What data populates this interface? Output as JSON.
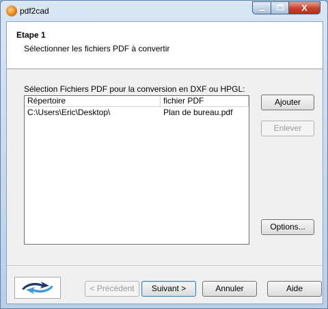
{
  "window": {
    "title": "pdf2cad",
    "close_glyph": "X"
  },
  "header": {
    "step_title": "Etape 1",
    "step_description": "Sélectionner les fichiers PDF à convertir"
  },
  "file_list": {
    "label": "Sélection Fichiers PDF pour la conversion en DXF ou HPGL:",
    "columns": [
      "Répertoire",
      "fichier PDF"
    ],
    "rows": [
      [
        "C:\\Users\\Eric\\Desktop\\",
        "Plan de bureau.pdf"
      ]
    ]
  },
  "side_buttons": {
    "add": "Ajouter",
    "remove": "Enlever",
    "options": "Options..."
  },
  "footer": {
    "previous": "< Précédent",
    "next": "Suivant >",
    "cancel": "Annuler",
    "help": "Aide"
  },
  "colors": {
    "close_button": "#c7412b",
    "logo_dark": "#1b3a6b",
    "logo_light": "#3a9ad9"
  },
  "icons": {
    "app": "pdf2cad-app-icon",
    "logo": "pdf2cad-logo-arrows"
  }
}
